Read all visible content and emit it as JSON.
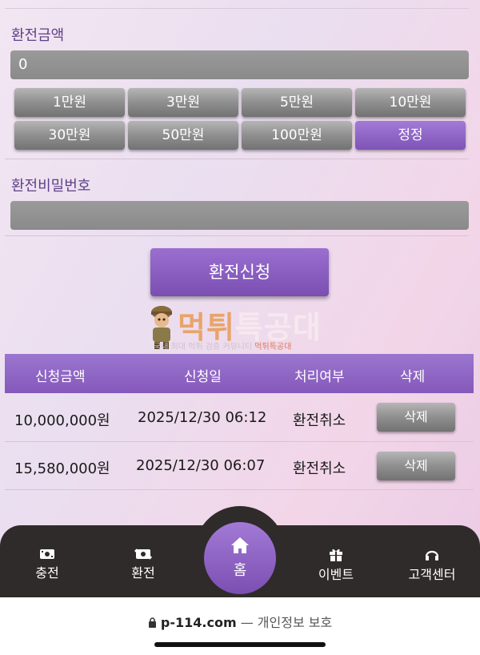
{
  "exchange": {
    "amount_label": "환전금액",
    "amount_value": "0",
    "amount_buttons": [
      "1만원",
      "3만원",
      "5만원",
      "10만원",
      "30만원",
      "50만원",
      "100만원",
      "정정"
    ],
    "password_label": "환전비밀번호",
    "password_value": "",
    "submit_label": "환전신청"
  },
  "logo": {
    "title_part1": "먹튀",
    "title_part2": "특공대",
    "subtitle_part1": "국내 최대 먹튀 검증 커뮤니티 ",
    "subtitle_part2": "먹튀특공대"
  },
  "table": {
    "headers": [
      "신청금액",
      "신청일",
      "처리여부",
      "삭제"
    ],
    "rows": [
      {
        "amount": "10,000,000원",
        "date": "2025/12/30 06:12",
        "status": "환전취소",
        "action": "삭제"
      },
      {
        "amount": "15,580,000원",
        "date": "2025/12/30 06:07",
        "status": "환전취소",
        "action": "삭제"
      }
    ]
  },
  "nav": {
    "items": [
      "충전",
      "환전",
      "홈",
      "이벤트",
      "고객센터"
    ]
  },
  "browser": {
    "domain": "p-114.com",
    "privacy_text": " — 개인정보 보호"
  },
  "colors": {
    "accent": "#8558bb",
    "button_gray": "#8f8f8f",
    "nav_bg": "#2f2b2b"
  }
}
